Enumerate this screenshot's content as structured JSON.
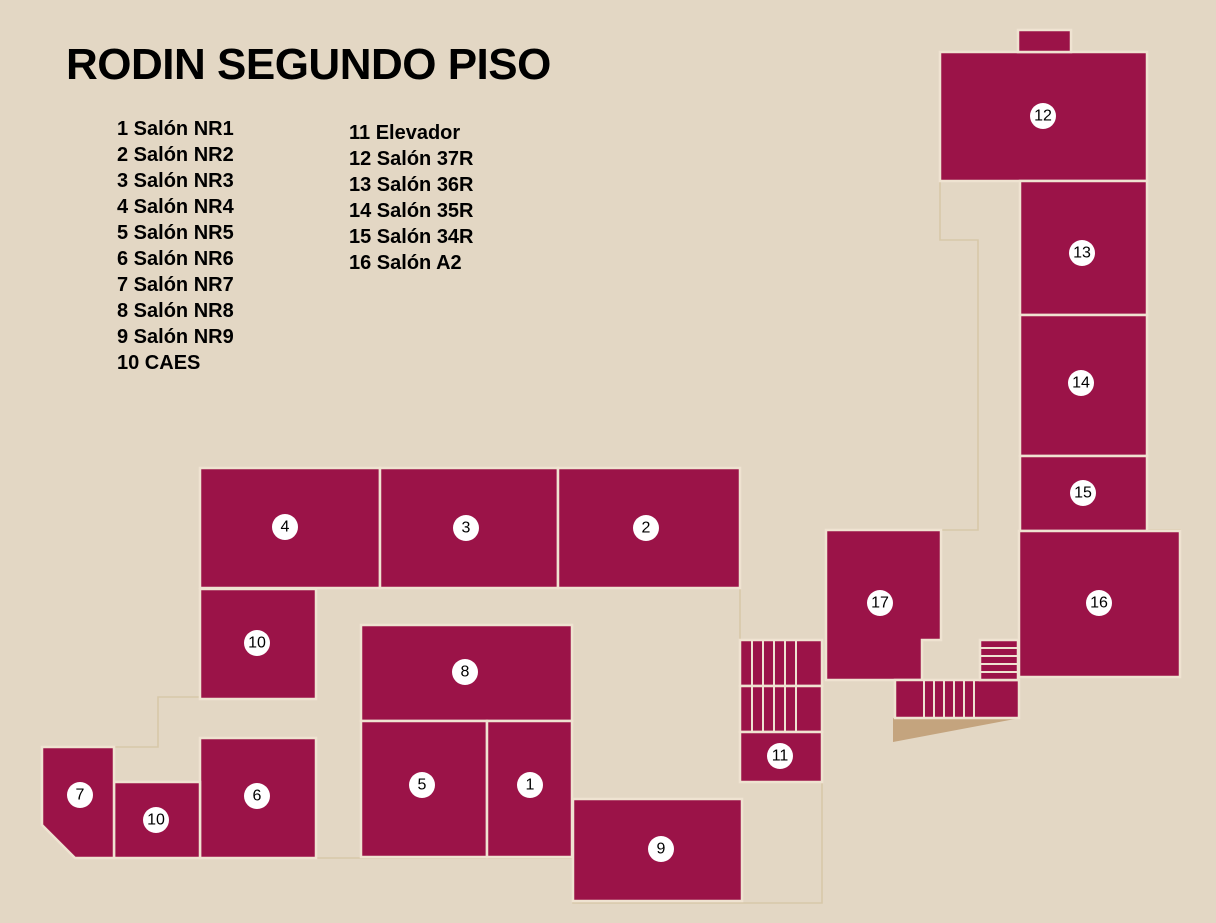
{
  "title": "RODIN SEGUNDO PISO",
  "legend_left": [
    "1 Salón NR1",
    "2 Salón NR2",
    "3 Salón NR3",
    "4 Salón NR4",
    "5 Salón NR5",
    "6 Salón NR6",
    "7 Salón NR7",
    "8 Salón NR8",
    "9 Salón NR9",
    "10 CAES"
  ],
  "legend_right": [
    "11 Elevador",
    "12 Salón 37R",
    "13 Salón 36R",
    "14 Salón 35R",
    "15 Salón 34R",
    "16 Salón A2"
  ],
  "room_labels": {
    "r1": "1",
    "r2": "2",
    "r3": "3",
    "r4": "4",
    "r5": "5",
    "r6": "6",
    "r7": "7",
    "r8": "8",
    "r9": "9",
    "r10a": "10",
    "r10b": "10",
    "r11": "11",
    "r12": "12",
    "r13": "13",
    "r14": "14",
    "r15": "15",
    "r16": "16",
    "r17": "17"
  },
  "colors": {
    "background": "#e3d7c4",
    "room_fill": "#9b1348",
    "room_border": "#efe3d1",
    "outline": "#d8c8a9",
    "badge": "#ffffff",
    "ramp": "#c4a47e"
  }
}
